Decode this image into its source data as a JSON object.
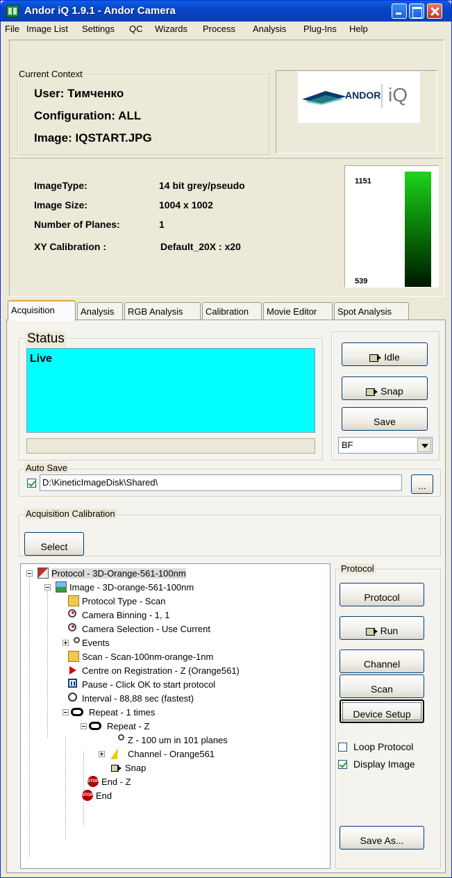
{
  "window": {
    "title": "Andor iQ 1.9.1 - Andor Camera"
  },
  "menubar": [
    "File",
    "Image List",
    "Settings",
    "QC",
    "Wizards",
    "Process",
    "Analysis",
    "Plug-Ins",
    "Help"
  ],
  "context": {
    "group_label": "Current Context",
    "user": "User:  Тимченко",
    "configuration": "Configuration:  ALL",
    "image": "Image:  IQSTART.JPG",
    "logo_text": "ANDOR",
    "logo_suffix": "iQ"
  },
  "image_info": {
    "rows": [
      {
        "label": "ImageType:",
        "value": "14 bit grey/pseudo"
      },
      {
        "label": "Image Size:",
        "value": "1004 x 1002"
      },
      {
        "label": "Number of Planes:",
        "value": "1"
      },
      {
        "label": "XY Calibration :",
        "value": "Default_20X : x20"
      }
    ],
    "lut_max": "1151",
    "lut_min": "539"
  },
  "tabs": [
    "Acquisition",
    "Analysis",
    "RGB Analysis",
    "Calibration",
    "Movie Editor",
    "Spot Analysis"
  ],
  "status": {
    "group_label": "Status",
    "text": "Live"
  },
  "buttons": {
    "idle": "Idle",
    "snap": "Snap",
    "save": "Save",
    "select": "Select",
    "browse": "...",
    "protocol": "Protocol",
    "run": "Run",
    "channel": "Channel",
    "scan": "Scan",
    "device_setup": "Device Setup",
    "save_as": "Save As..."
  },
  "mode_select": {
    "value": "BF"
  },
  "auto_save": {
    "group_label": "Auto Save",
    "checked": true,
    "path": "D:\\KineticImageDisk\\Shared\\"
  },
  "acq_calibration": {
    "group_label": "Acquisition Calibration"
  },
  "protocol_panel": {
    "group_label": "Protocol",
    "loop_protocol": "Loop Protocol",
    "display_image": "Display Image"
  },
  "tree": [
    {
      "label": "Protocol - 3D-Orange-561-100nm",
      "icon": "protocol-icon"
    },
    {
      "label": "Image - 3D-orange-561-100nm",
      "icon": "image-icon"
    },
    {
      "label": "Protocol Type - Scan",
      "icon": "folder-icon"
    },
    {
      "label": "Camera Binning - 1, 1",
      "icon": "zoom-icon"
    },
    {
      "label": "Camera Selection - Use Current",
      "icon": "zoom-icon"
    },
    {
      "label": "Events",
      "icon": "key-icon"
    },
    {
      "label": "Scan - Scan-100nm-orange-1nm",
      "icon": "folder-icon"
    },
    {
      "label": "Centre on Registration - Z (Orange561)",
      "icon": "arrow-icon"
    },
    {
      "label": "Pause - Click OK to start protocol",
      "icon": "pause-icon"
    },
    {
      "label": "Interval - 88,88 sec (fastest)",
      "icon": "clock-icon"
    },
    {
      "label": "Repeat - 1 times",
      "icon": "repeat-icon"
    },
    {
      "label": "Repeat - Z",
      "icon": "repeat-icon"
    },
    {
      "label": "Z - 100 um in 101 planes",
      "icon": "key-icon"
    },
    {
      "label": "Channel - Orange561",
      "icon": "lightning-icon"
    },
    {
      "label": "Snap",
      "icon": "camera-icon"
    },
    {
      "label": "End - Z",
      "icon": "stop-icon"
    },
    {
      "label": "End",
      "icon": "stop-icon"
    }
  ]
}
